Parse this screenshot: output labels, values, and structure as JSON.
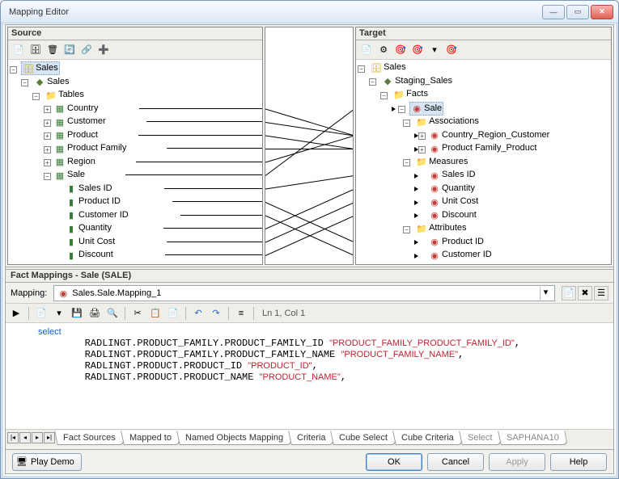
{
  "window": {
    "title": "Mapping Editor"
  },
  "panes": {
    "source": {
      "header": "Source"
    },
    "target": {
      "header": "Target"
    }
  },
  "source_tree": {
    "root": "Sales",
    "schema": "Sales",
    "tables_label": "Tables",
    "tables": [
      {
        "name": "Country"
      },
      {
        "name": "Customer"
      },
      {
        "name": "Product"
      },
      {
        "name": "Product Family"
      },
      {
        "name": "Region"
      },
      {
        "name": "Sale",
        "expanded": true,
        "cols": [
          "Sales ID",
          "Product ID",
          "Customer ID",
          "Quantity",
          "Unit Cost",
          "Discount"
        ]
      }
    ]
  },
  "target_tree": {
    "root": "Sales",
    "staging": "Staging_Sales",
    "facts_label": "Facts",
    "fact": "Sale",
    "assoc_label": "Associations",
    "associations": [
      "Country_Region_Customer",
      "Product Family_Product"
    ],
    "measures_label": "Measures",
    "measures": [
      "Sales ID",
      "Quantity",
      "Unit Cost",
      "Discount"
    ],
    "attrs_label": "Attributes",
    "attributes": [
      "Product ID",
      "Customer ID"
    ]
  },
  "fact_mappings": {
    "header": "Fact Mappings - Sale (SALE)",
    "mapping_label": "Mapping:",
    "mapping_value": "Sales.Sale.Mapping_1"
  },
  "editor": {
    "status": "Ln 1, Col 1",
    "code_kw": "select",
    "lines": [
      {
        "pre": "RADLINGT.PRODUCT_FAMILY.PRODUCT_FAMILY_ID ",
        "str": "\"PRODUCT_FAMILY_PRODUCT_FAMILY_ID\"",
        "suf": ","
      },
      {
        "pre": "RADLINGT.PRODUCT_FAMILY.PRODUCT_FAMILY_NAME ",
        "str": "\"PRODUCT_FAMILY_NAME\"",
        "suf": ","
      },
      {
        "pre": "RADLINGT.PRODUCT.PRODUCT_ID ",
        "str": "\"PRODUCT_ID\"",
        "suf": ","
      },
      {
        "pre": "RADLINGT.PRODUCT.PRODUCT_NAME ",
        "str": "\"PRODUCT_NAME\"",
        "suf": ","
      }
    ]
  },
  "tabs": [
    "Fact Sources",
    "Mapped to",
    "Named Objects Mapping",
    "Criteria",
    "Cube Select",
    "Cube Criteria",
    "Select",
    "SAPHANA10"
  ],
  "footer": {
    "demo": "Play Demo",
    "ok": "OK",
    "cancel": "Cancel",
    "apply": "Apply",
    "help": "Help"
  }
}
